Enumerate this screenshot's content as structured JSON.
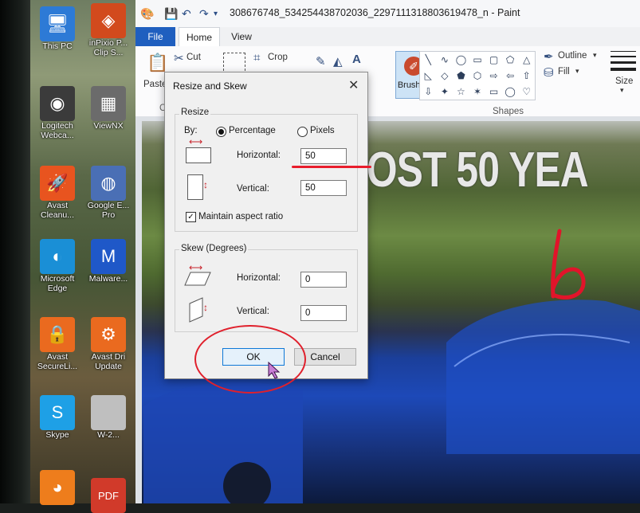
{
  "desktop": {
    "icons": [
      {
        "label1": "This PC",
        "label2": "",
        "glyph": "🖥",
        "color": "#2d7ad6"
      },
      {
        "label1": "inPixio P...",
        "label2": "Clip S...",
        "glyph": "◈",
        "color": "#d24a1d"
      },
      {
        "label1": "Logitech",
        "label2": "Webca...",
        "glyph": "◉",
        "color": "#3b3b3b"
      },
      {
        "label1": "ViewNX",
        "label2": "",
        "glyph": "▦",
        "color": "#6b6b6b"
      },
      {
        "label1": "Avast",
        "label2": "Cleanu...",
        "glyph": "🚀",
        "color": "#e8541f"
      },
      {
        "label1": "Google E...",
        "label2": "Pro",
        "glyph": "◍",
        "color": "#4a6fb5"
      },
      {
        "label1": "Microsoft",
        "label2": "Edge",
        "glyph": "◐",
        "color": "#1a8fd6"
      },
      {
        "label1": "Malware...",
        "label2": "",
        "glyph": "M",
        "color": "#1f58c8"
      },
      {
        "label1": "Avast",
        "label2": "SecureLi...",
        "glyph": "🔒",
        "color": "#ea6a1f"
      },
      {
        "label1": "Avast Dri",
        "label2": "Update",
        "glyph": "⚙",
        "color": "#ea6a1f"
      },
      {
        "label1": "Skype",
        "label2": "",
        "glyph": "S",
        "color": "#1ea0e6"
      },
      {
        "label1": "W-2...",
        "label2": "",
        "glyph": "",
        "color": "#bfbfbf"
      },
      {
        "label1": "",
        "label2": "",
        "glyph": "◕",
        "color": "#ee7d1c"
      },
      {
        "label1": "",
        "label2": "",
        "glyph": "PDF",
        "color": "#d13a2a"
      }
    ]
  },
  "window": {
    "title": "308676748_534254438702036_2297111318803619478_n - Paint",
    "tabs": {
      "file": "File",
      "home": "Home",
      "view": "View"
    }
  },
  "ribbon": {
    "paste": "Paste",
    "cut": "Cut",
    "crop": "Crop",
    "clipboard_group": "Cli",
    "brushes": "Brushes",
    "shapes_group": "Shapes",
    "outline": "Outline",
    "fill": "Fill",
    "size": "Size"
  },
  "photo": {
    "text": "OST 50 YEA"
  },
  "dialog": {
    "title": "Resize and Skew",
    "resize_group": "Resize",
    "by_label": "By:",
    "percentage_label": "Percentage",
    "pixels_label": "Pixels",
    "horizontal_label": "Horizontal:",
    "horizontal_value": "50",
    "vertical_label": "Vertical:",
    "vertical_value": "50",
    "maintain_label": "Maintain aspect ratio",
    "skew_group": "Skew (Degrees)",
    "skew_horizontal_label": "Horizontal:",
    "skew_horizontal_value": "0",
    "skew_vertical_label": "Vertical:",
    "skew_vertical_value": "0",
    "ok": "OK",
    "cancel": "Cancel",
    "close": "✕"
  },
  "annotation": {
    "handwritten_mark": "b"
  }
}
